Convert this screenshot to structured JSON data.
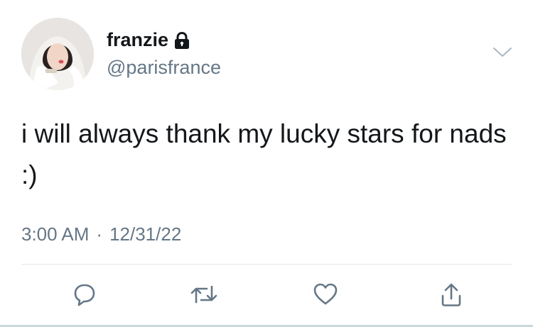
{
  "tweet": {
    "author": {
      "display_name": "franzie",
      "handle": "@parisfrance",
      "protected_icon": "lock-icon",
      "avatar_icon": "avatar"
    },
    "text": "i will always thank my lucky stars for nads :)",
    "time": "3:00 AM",
    "separator": "·",
    "date": "12/31/22"
  },
  "actions": [
    {
      "name": "reply",
      "icon": "speech-bubble-icon"
    },
    {
      "name": "retweet",
      "icon": "retweet-arrows-icon"
    },
    {
      "name": "like",
      "icon": "heart-icon"
    },
    {
      "name": "share",
      "icon": "share-upload-icon"
    }
  ],
  "colors": {
    "primary_text": "#14171a",
    "secondary_text": "#657786",
    "icon_gray": "#657786",
    "divider": "#e1e8ed"
  }
}
